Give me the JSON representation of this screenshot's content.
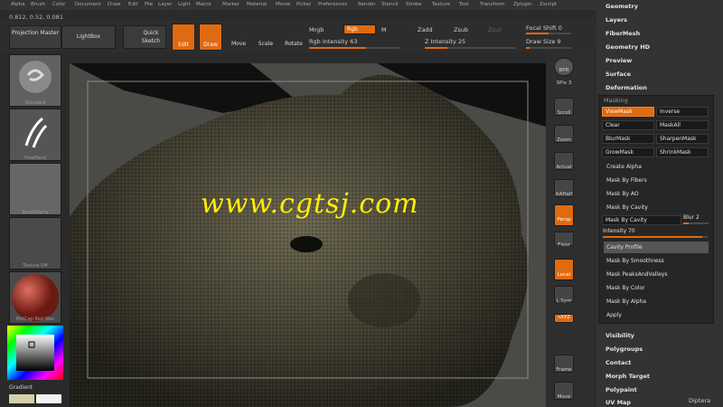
{
  "menu": [
    "Alpha",
    "Brush",
    "Color",
    "Document",
    "Draw",
    "Edit",
    "File",
    "Layer",
    "Light",
    "Macro",
    "Marker",
    "Material",
    "Movie",
    "Picker",
    "Preferences",
    "Render",
    "Stencil",
    "Stroke",
    "Texture",
    "Tool",
    "Transform",
    "Zplugin",
    "Zscript"
  ],
  "numbers": "0.812, 0.52, 0.081",
  "toolbar": {
    "projection_master": "Projection Master",
    "lightbox": "LightBox",
    "quick_sketch": "Quick Sketch",
    "edit": "Edit",
    "draw": "Draw",
    "move": "Move",
    "scale": "Scale",
    "rotate": "Rotate",
    "mrgb": "Mrgb",
    "rgb": "Rgb",
    "m": "M",
    "zadd": "Zadd",
    "zsub": "Zsub",
    "zcut": "Zcut",
    "rgb_intensity": "Rgb Intensity 63",
    "z_intensity": "Z Intensity 25",
    "focal_shift": "Focal Shift 0",
    "draw_size": "Draw Size 9"
  },
  "left_shelf": {
    "brush": "Standard",
    "stroke": "FreeHand",
    "alpha": "BrushAlpha",
    "texture": "Texture Off",
    "material": "MatCap Red Wax",
    "gradient": "Gradient"
  },
  "canvas": {
    "watermark": "www.cgtsj.com"
  },
  "right_shelf": {
    "bpr": "BPR",
    "spix": "SPix 3",
    "scroll": "Scroll",
    "zoom": "Zoom",
    "actual": "Actual",
    "aahalf": "AAHalf",
    "persp": "Persp",
    "floor": "Floor",
    "local": "Local",
    "lsym": "L.Sym",
    "xyz": "»XYZ",
    "frame": "Frame",
    "move": "Move"
  },
  "palette": {
    "top_items": [
      "Geometry",
      "Layers",
      "FiberMesh",
      "Geometry HD",
      "Preview",
      "Surface",
      "Deformation"
    ],
    "masking_title": "Masking",
    "mask_buttons": [
      {
        "label": "ViewMask",
        "active": true
      },
      {
        "label": "Inverse",
        "active": false
      },
      {
        "label": "Clear",
        "active": false
      },
      {
        "label": "MaskAll",
        "active": false
      },
      {
        "label": "BlurMask",
        "active": false
      },
      {
        "label": "SharpenMask",
        "active": false
      },
      {
        "label": "GrowMask",
        "active": false
      },
      {
        "label": "ShrinkMask",
        "active": false
      }
    ],
    "create_alpha": "Create Alpha",
    "mask_by_fibers": "Mask By Fibers",
    "mask_by_ao": "Mask By AO",
    "mask_by_cavity": "Mask By Cavity",
    "mask_by_cavity_btn": "Mask By Cavity",
    "blur": "Blur 2",
    "intensity": "Intensity 70",
    "cavity_profile": "Cavity Profile",
    "mask_by_smoothness": "Mask By Smoothness",
    "mask_peaks": "Mask PeaksAndValleys",
    "mask_by_color": "Mask By Color",
    "mask_by_alpha": "Mask By Alpha",
    "apply": "Apply",
    "bottom_items": [
      "Visibility",
      "Polygroups",
      "Contact",
      "Morph Target",
      "Polypaint",
      "UV Map"
    ],
    "footer": "Diptera"
  },
  "colors": {
    "accent": "#e06a10",
    "panel": "#333333",
    "canvas": "#4a4a47"
  }
}
